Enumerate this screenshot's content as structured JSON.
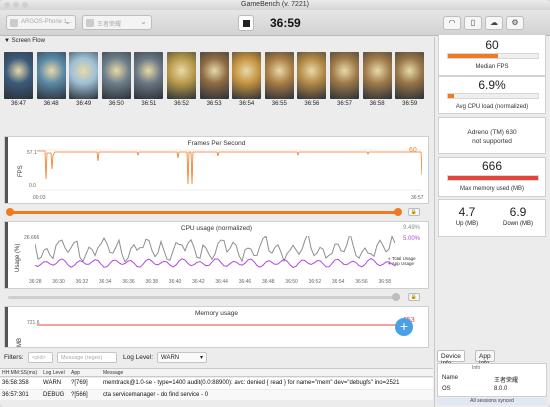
{
  "window": {
    "title": "GameBench (v. 7221)"
  },
  "colors": {
    "accent": "#f07a22",
    "purple": "#b04ad9",
    "gray_line": "#8a8f8f",
    "red_line": "#e4433a",
    "fab": "#4aa0e6"
  },
  "toolbar": {
    "device_dropdown": "ARGOS-Phone 1...",
    "app_dropdown": "王者荣耀",
    "timer": "36:59",
    "icons": [
      "wifi-icon",
      "trash-icon",
      "cloud-upload-icon",
      "settings-icon"
    ]
  },
  "screen_flow": {
    "header": "Screen Flow",
    "thumbnails": [
      {
        "time": "36:47",
        "tone": "#3b5a7a"
      },
      {
        "time": "36:48",
        "tone": "#5a88a6"
      },
      {
        "time": "36:49",
        "tone": "#9fc0d6"
      },
      {
        "time": "36:50",
        "tone": "#6d7f8a"
      },
      {
        "time": "36:51",
        "tone": "#6a7684"
      },
      {
        "time": "36:52",
        "tone": "#b89a4a"
      },
      {
        "time": "36:53",
        "tone": "#8d6a43"
      },
      {
        "time": "36:54",
        "tone": "#c49342"
      },
      {
        "time": "36:55",
        "tone": "#a87d45"
      },
      {
        "time": "36:56",
        "tone": "#b28847"
      },
      {
        "time": "36:57",
        "tone": "#9d7a48"
      },
      {
        "time": "36:58",
        "tone": "#a07b4b"
      },
      {
        "time": "36:59",
        "tone": "#977548"
      }
    ]
  },
  "fps_chart": {
    "title": "Frames Per Second",
    "ylabel": "FPS",
    "current_label": "60",
    "y_top_tick": "57.1",
    "y_bottom_tick": "0.0",
    "x_start": "00:03",
    "x_end": "36:57"
  },
  "cpu_chart": {
    "title": "CPU usage (normalized)",
    "ylabel": "Usage (%)",
    "y_top_tick": "26.666",
    "total_label": "9.49%",
    "app_label": "5.00%",
    "legend_total": "Total Usage",
    "legend_app": "App Usage",
    "x_ticks": [
      "36:28",
      "36:30",
      "36:32",
      "36:34",
      "36:36",
      "36:38",
      "36:40",
      "36:42",
      "36:44",
      "36:46",
      "36:48",
      "36:50",
      "36:52",
      "36:54",
      "36:56",
      "36:58"
    ]
  },
  "memory_chart": {
    "title": "Memory usage",
    "ylabel": "MB",
    "y_top_tick": "721.6",
    "current_label": "653"
  },
  "filters": {
    "label": "Filters:",
    "pid_placeholder": "<pid>",
    "message_placeholder": "Message (regex)",
    "log_level_label": "Log Level:",
    "log_level_value": "WARN"
  },
  "log": {
    "columns": [
      "HH:MM:SS(ms)",
      "Log Level",
      "App",
      "Message"
    ],
    "rows": [
      {
        "time": "36:58:358",
        "level": "WARN",
        "app": "?[769]",
        "message": "memtrack@1.0-se - type=1400 audit(0.0:88900): avc: denied { read } for name=\"mem\" dev=\"debugfs\" ino=2521"
      },
      {
        "time": "36:57:301",
        "level": "DEBUG",
        "app": "?[566]",
        "message": "cta servicemanager - do find service - 0"
      }
    ]
  },
  "sidebar": {
    "median_fps": {
      "value": "60",
      "label": "Median FPS",
      "fill": 0.55
    },
    "avg_cpu": {
      "value": "6.9%",
      "label": "Avg CPU load (normalized)",
      "fill": 0.07
    },
    "gpu": {
      "line1": "Adreno (TM) 630",
      "line2": "not supported"
    },
    "max_memory": {
      "value": "666",
      "label": "Max memory used (MB)",
      "fill": 1.0
    },
    "network": {
      "up_value": "4.7",
      "up_label": "Up (MB)",
      "down_value": "6.9",
      "down_label": "Down (MB)"
    },
    "tabs": [
      "Device info",
      "App info"
    ],
    "info": {
      "header": "Info",
      "rows": [
        {
          "k": "Name",
          "v": "王者荣耀"
        },
        {
          "k": "OS",
          "v": "8.0.0"
        }
      ]
    },
    "status": "All sessions synced"
  }
}
